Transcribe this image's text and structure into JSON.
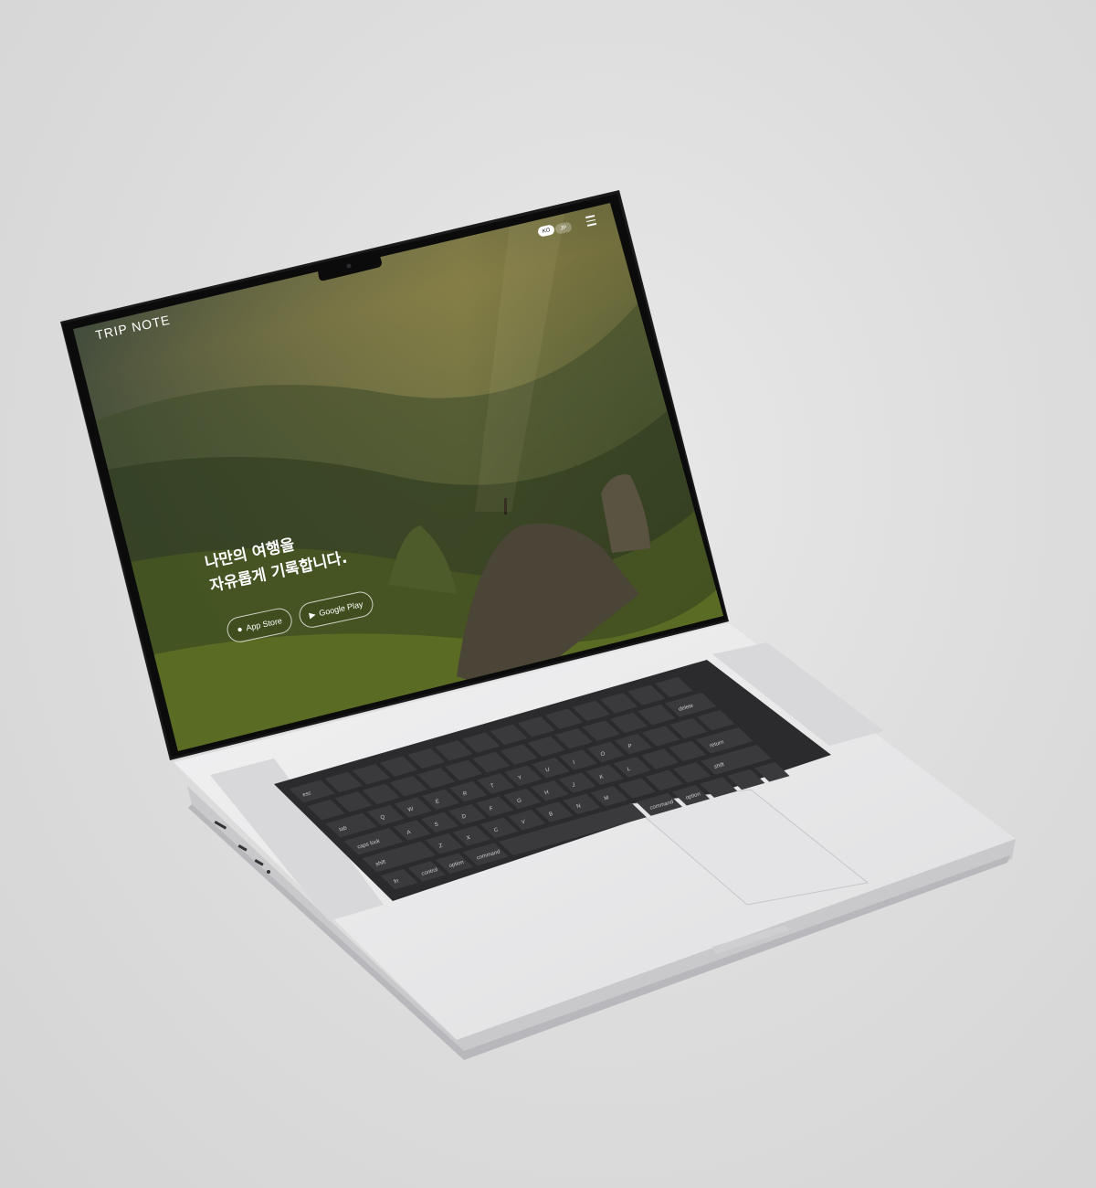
{
  "site": {
    "logo": "TRIP NOTE",
    "hero_line1": "나만의 여행을",
    "hero_line2": "자유롭게 기록합니다.",
    "app_store_label": "App Store",
    "google_play_label": "Google Play",
    "lang_ko": "KO",
    "lang_jp": "JP"
  },
  "keyboard": {
    "esc": "esc",
    "delete": "delete",
    "tab": "tab",
    "caps": "caps lock",
    "return": "return",
    "shift_l": "shift",
    "shift_r": "shift",
    "fn": "fn",
    "control": "control",
    "option_l": "option",
    "command_l": "command",
    "command_r": "command",
    "option_r": "option",
    "row2": [
      "Q",
      "W",
      "E",
      "R",
      "T",
      "Y",
      "U",
      "I",
      "O",
      "P"
    ],
    "row3": [
      "A",
      "S",
      "D",
      "F",
      "G",
      "H",
      "J",
      "K",
      "L"
    ],
    "row4": [
      "Z",
      "X",
      "C",
      "V",
      "B",
      "N",
      "M"
    ]
  },
  "colors": {
    "accent": "#ffffff",
    "body": "#e6e6e8",
    "keys": "#2d2d2f"
  }
}
